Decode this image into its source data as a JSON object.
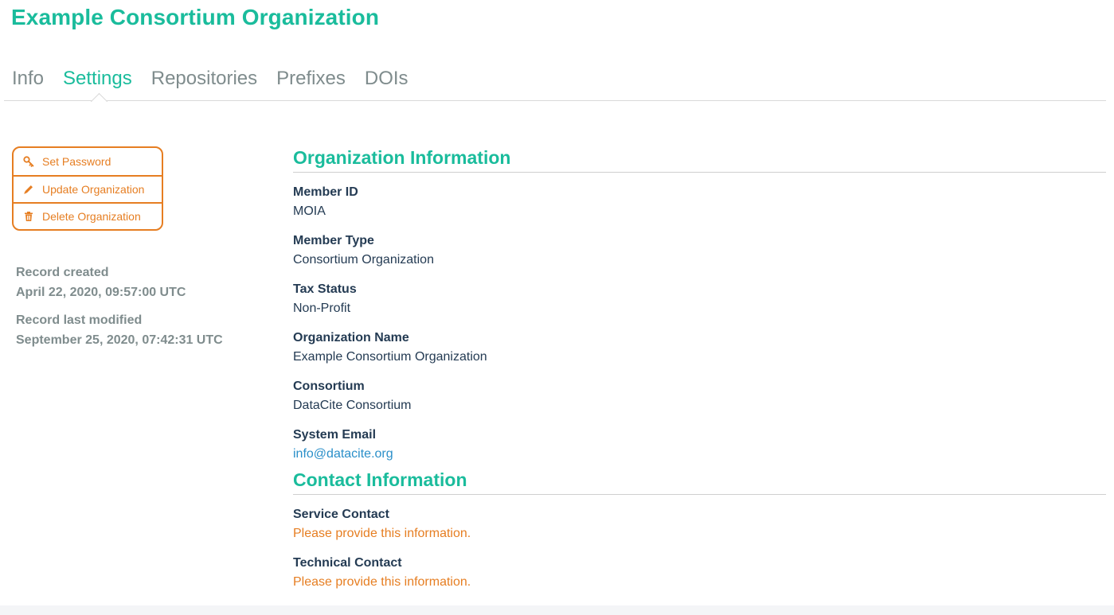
{
  "header": {
    "title": "Example Consortium Organization"
  },
  "tabs": [
    {
      "label": "Info",
      "active": false
    },
    {
      "label": "Settings",
      "active": true
    },
    {
      "label": "Repositories",
      "active": false
    },
    {
      "label": "Prefixes",
      "active": false
    },
    {
      "label": "DOIs",
      "active": false
    }
  ],
  "actions": {
    "set_password": {
      "label": "Set Password",
      "icon": "key-icon"
    },
    "update_organization": {
      "label": "Update Organization",
      "icon": "pencil-icon"
    },
    "delete_organization": {
      "label": "Delete Organization",
      "icon": "trash-icon"
    }
  },
  "record": {
    "created_label": "Record created",
    "created_value": "April 22, 2020, 09:57:00 UTC",
    "modified_label": "Record last modified",
    "modified_value": "September 25, 2020, 07:42:31 UTC"
  },
  "organization_info": {
    "heading": "Organization Information",
    "fields": [
      {
        "label": "Member ID",
        "value": "MOIA"
      },
      {
        "label": "Member Type",
        "value": "Consortium Organization"
      },
      {
        "label": "Tax Status",
        "value": "Non-Profit"
      },
      {
        "label": "Organization Name",
        "value": "Example Consortium Organization"
      },
      {
        "label": "Consortium",
        "value": "DataCite Consortium"
      },
      {
        "label": "System Email",
        "value": "info@datacite.org"
      }
    ]
  },
  "contact_info": {
    "heading": "Contact Information",
    "fields": [
      {
        "label": "Service Contact",
        "value": "Please provide this information."
      },
      {
        "label": "Technical Contact",
        "value": "Please provide this information."
      }
    ]
  },
  "colors": {
    "accent": "#1abc9c",
    "warning": "#e67e22",
    "link": "#2a8fc9",
    "muted": "#7f8c8d",
    "text": "#243b53"
  }
}
